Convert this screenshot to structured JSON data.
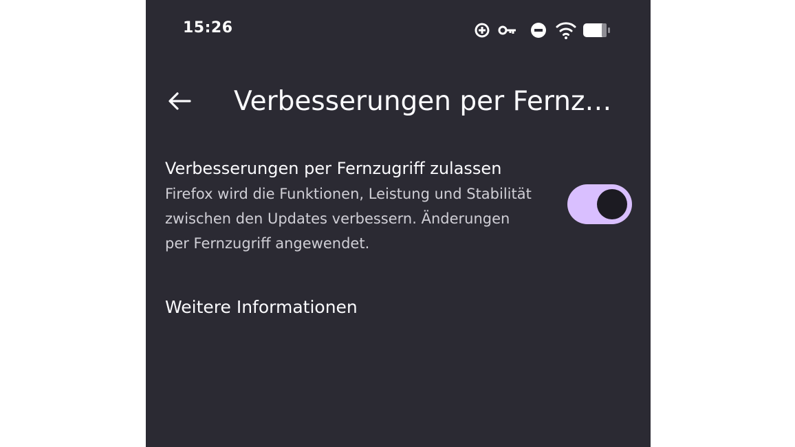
{
  "status_bar": {
    "time": "15:26",
    "icons": [
      "data-saver-icon",
      "vpn-key-icon",
      "do-not-disturb-icon",
      "wifi-icon",
      "battery-icon"
    ]
  },
  "toolbar": {
    "back_icon": "arrow-left-icon",
    "title": "Verbesserungen per Fernzugriff zulassen"
  },
  "setting": {
    "title": "Verbesserungen per Fernzugriff zulassen",
    "description": "Firefox wird die Funktionen, Leistung und Stabilität zwischen den Updates verbessern. Änderungen per Fernzugriff angewendet.",
    "enabled": true
  },
  "links": {
    "more_info": "Weitere Informationen"
  },
  "colors": {
    "background": "#2b2a33",
    "text": "#fbfbfe",
    "secondary_text": "#d0cfd6",
    "toggle_track": "#d9bfff",
    "toggle_knob": "#1c1b22"
  }
}
